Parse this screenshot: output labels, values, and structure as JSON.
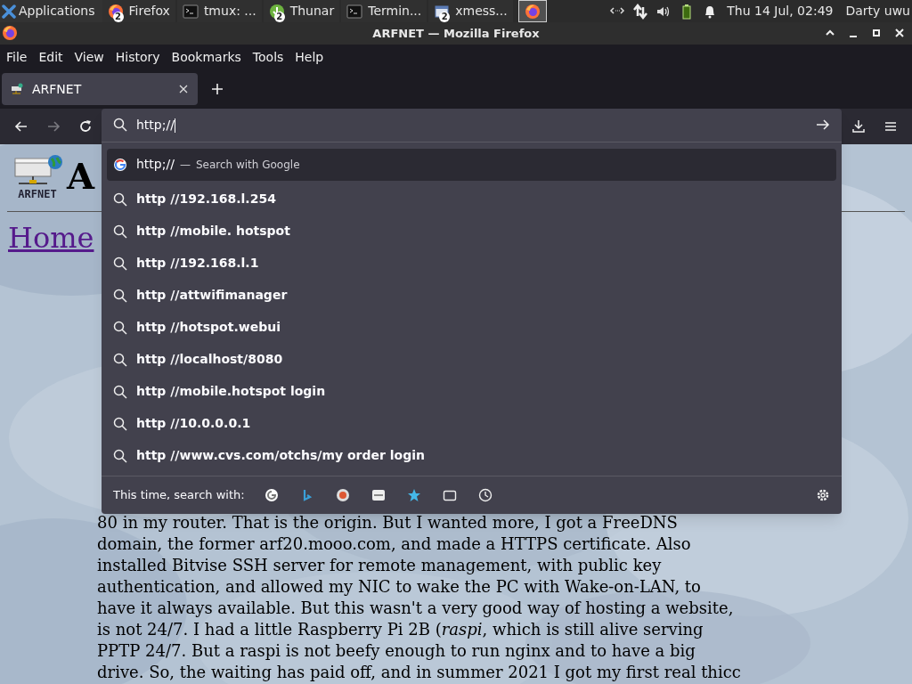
{
  "taskbar": {
    "apps_menu": "Applications",
    "tasks": [
      {
        "kind": "firefox",
        "label": "Firefox",
        "badge": "2",
        "selected": false
      },
      {
        "kind": "terminal",
        "label": "tmux: ...",
        "selected": false
      },
      {
        "kind": "files",
        "label": "Thunar",
        "badge": "2",
        "selected": false
      },
      {
        "kind": "terminal",
        "label": "Termin...",
        "selected": false
      },
      {
        "kind": "window",
        "label": "xmess...",
        "badge": "2",
        "selected": false
      },
      {
        "kind": "firefox",
        "selected": true
      }
    ],
    "tray": [
      {
        "kind": "network"
      },
      {
        "kind": "transfer"
      },
      {
        "kind": "volume"
      },
      {
        "kind": "battery"
      },
      {
        "kind": "bell"
      }
    ],
    "clock": "Thu 14 Jul, 02:49",
    "user": "Darty uwu"
  },
  "window": {
    "title": "ARFNET — Mozilla Firefox"
  },
  "menu": [
    {
      "label": "File"
    },
    {
      "label": "Edit"
    },
    {
      "label": "View"
    },
    {
      "label": "History"
    },
    {
      "label": "Bookmarks"
    },
    {
      "label": "Tools"
    },
    {
      "label": "Help"
    }
  ],
  "tabs": [
    {
      "title": "ARFNET",
      "selected": true
    }
  ],
  "toolbar": {
    "back_disabled": false,
    "forward_disabled": true
  },
  "urlbar": {
    "value": "http;//"
  },
  "suggestions": [
    {
      "kind": "engine",
      "text": "http;//",
      "separator": "—",
      "action": "Search with Google",
      "selected": true
    },
    {
      "kind": "search",
      "text": "http //192.168.l.254",
      "selected": false
    },
    {
      "kind": "search",
      "text": "http //mobile. hotspot",
      "selected": false
    },
    {
      "kind": "search",
      "text": "http //192.168.l.1",
      "selected": false
    },
    {
      "kind": "search",
      "text": "http //attwifimanager",
      "selected": false
    },
    {
      "kind": "search",
      "text": "http //hotspot.webui",
      "selected": false
    },
    {
      "kind": "search",
      "text": "http //localhost/8080",
      "selected": false
    },
    {
      "kind": "search",
      "text": "http //mobile.hotspot login",
      "selected": false
    },
    {
      "kind": "search",
      "text": "http //10.0.0.0.1",
      "selected": false
    },
    {
      "kind": "search",
      "text": "http //www.cvs.com/otchs/my order login",
      "selected": false
    }
  ],
  "one_offs": {
    "label": "This time, search with:",
    "engines": [
      {
        "kind": "google"
      },
      {
        "kind": "bing"
      },
      {
        "kind": "duckduckgo"
      },
      {
        "kind": "ebay"
      },
      {
        "kind": "bookmarks"
      },
      {
        "kind": "tabs"
      },
      {
        "kind": "history"
      }
    ]
  },
  "page": {
    "logo_text": "ARFNET",
    "heading": "A",
    "nav_link": "Home",
    "lines": [
      "80 in my router. That is the origin. But I wanted more, I got a FreeDNS",
      "domain, the former arf20.mooo.com, and made a HTTPS certificate. Also",
      "installed Bitvise SSH server for remote management, with public key",
      "authentication, and allowed my NIC to wake the PC with Wake-on-LAN, to",
      "have it always available. But this wasn't a very good way of hosting a website,",
      "is not 24/7. I had a little Raspberry Pi 2B (*raspi*, which is still alive serving",
      "PPTP 24/7. But a raspi is not beefy enough to run nginx and to have a big",
      "drive. So, the waiting has paid off, and in summer 2021 I got my first real thicc"
    ]
  }
}
